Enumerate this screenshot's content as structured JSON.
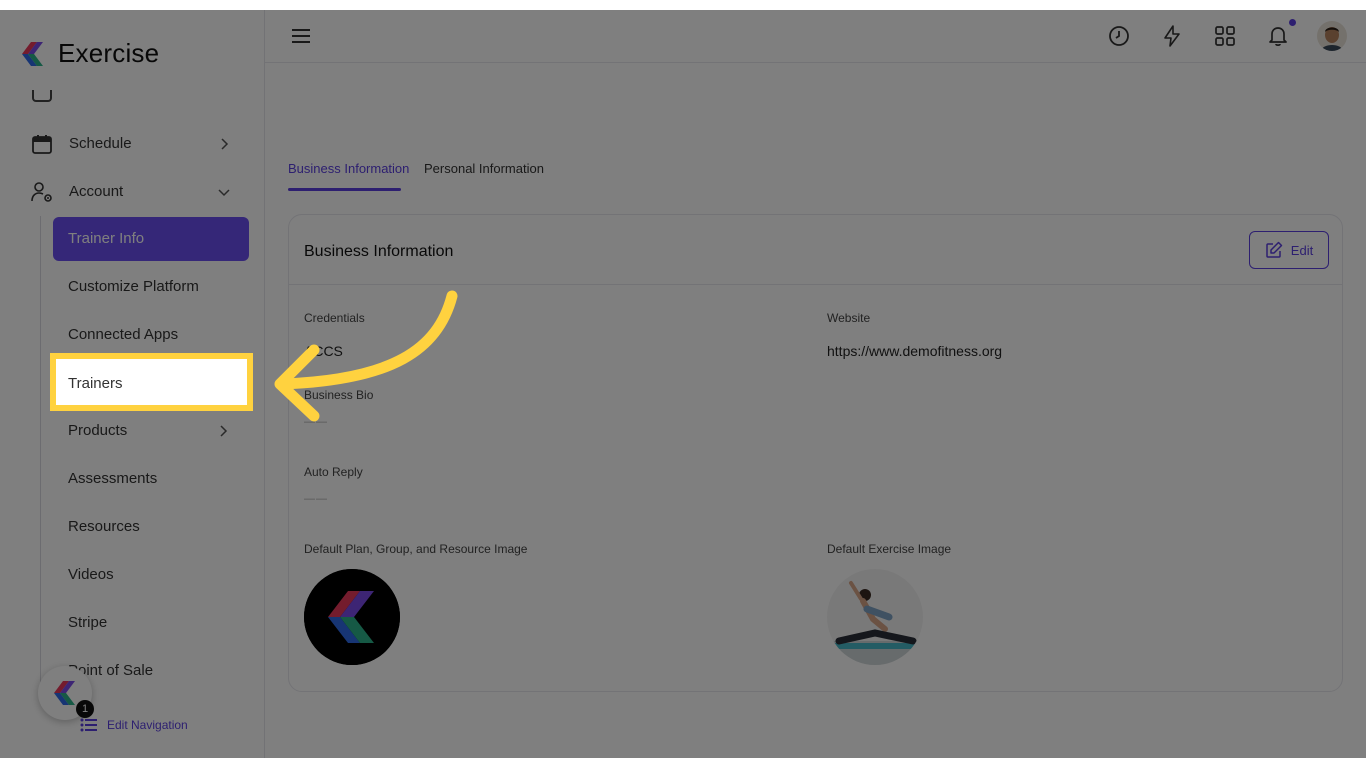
{
  "app": {
    "name": "Exercise"
  },
  "sidebar": {
    "items": [
      {
        "label": "Schedule",
        "icon": "calendar-icon"
      },
      {
        "label": "Account",
        "icon": "user-gear-icon"
      }
    ],
    "sub_items": [
      {
        "label": "Trainer Info",
        "active": true
      },
      {
        "label": "Customize Platform"
      },
      {
        "label": "Connected Apps"
      },
      {
        "label": "Trainers"
      },
      {
        "label": "Products",
        "has_children": true
      },
      {
        "label": "Assessments"
      },
      {
        "label": "Resources"
      },
      {
        "label": "Videos"
      },
      {
        "label": "Stripe"
      },
      {
        "label": "Point of Sale"
      }
    ],
    "help_badge_count": "1",
    "edit_nav_label": "Edit Navigation"
  },
  "header": {
    "icons": [
      "menu-icon",
      "clock-icon",
      "bolt-icon",
      "apps-grid-icon",
      "bell-icon",
      "avatar"
    ]
  },
  "tabs": [
    {
      "label": "Business Information",
      "active": true
    },
    {
      "label": "Personal Information"
    }
  ],
  "card": {
    "title": "Business Information",
    "edit_label": "Edit",
    "credentials_label": "Credentials",
    "credentials_value": "ACCS",
    "website_label": "Website",
    "website_value": "https://www.demofitness.org",
    "bio_label": "Business Bio",
    "bio_value": "——",
    "auto_reply_label": "Auto Reply",
    "auto_reply_value": "——",
    "default_image_label": "Default Plan, Group, and Resource Image",
    "default_exercise_label": "Default Exercise Image"
  },
  "colors": {
    "accent": "#5b3fe0",
    "highlight": "#ffd23f",
    "overlay": "rgba(0,0,0,0.5)"
  }
}
